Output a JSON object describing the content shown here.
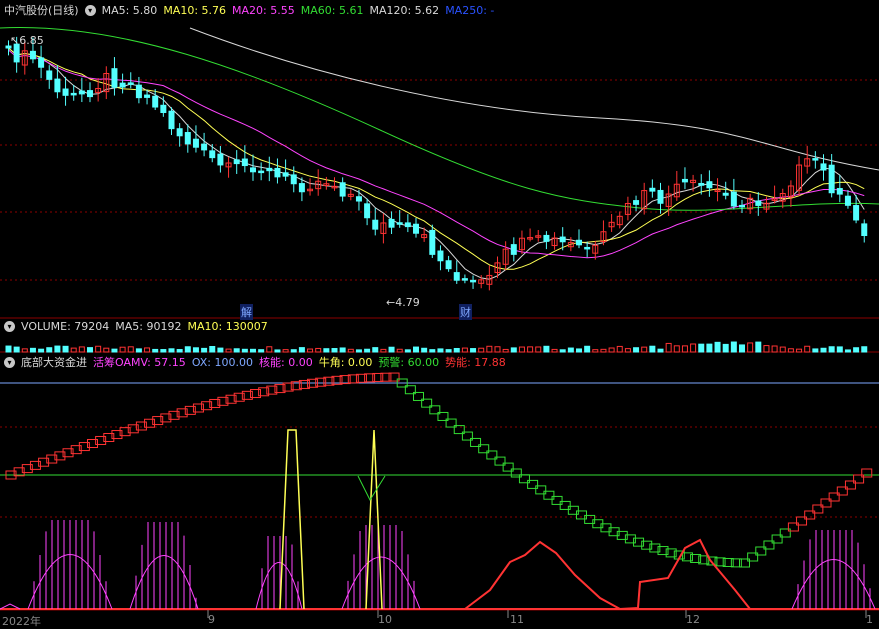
{
  "main_panel": {
    "stock_name": "中汽股份",
    "period": "(日线)",
    "ma": [
      {
        "label": "MA5: 5.80",
        "color": "#d8d8d8"
      },
      {
        "label": "MA10: 5.76",
        "color": "#ffff55"
      },
      {
        "label": "MA20: 5.55",
        "color": "#ff44ff"
      },
      {
        "label": "MA60: 5.61",
        "color": "#33dd33"
      },
      {
        "label": "MA120: 5.62",
        "color": "#d8d8d8"
      },
      {
        "label": "MA250: -",
        "color": "#2a52ff"
      }
    ],
    "high_label": "6.85",
    "low_label": "←4.79",
    "event_markers": [
      "解",
      "财"
    ]
  },
  "volume_panel": {
    "label": "VOLUME: 79204",
    "ma5": "MA5: 90192",
    "ma10": "MA10: 130007"
  },
  "indicator_panel": {
    "name": "底部大资金进",
    "items": [
      {
        "label": "活筹OAMV: 57.15",
        "color": "#ff44ff"
      },
      {
        "label": "OX: 100.00",
        "color": "#7ea7ff"
      },
      {
        "label": "核能: 0.00",
        "color": "#ff44ff"
      },
      {
        "label": "牛角: 0.00",
        "color": "#ffff55"
      },
      {
        "label": "预警: 60.00",
        "color": "#33dd33"
      },
      {
        "label": "势能: 17.88",
        "color": "#ff3333"
      }
    ]
  },
  "time_axis": {
    "labels": [
      "2022年",
      "9",
      "10",
      "11",
      "12",
      "1"
    ]
  },
  "colors": {
    "up": "#ff3333",
    "down": "#54ffff",
    "grid": "#8b0000"
  }
}
